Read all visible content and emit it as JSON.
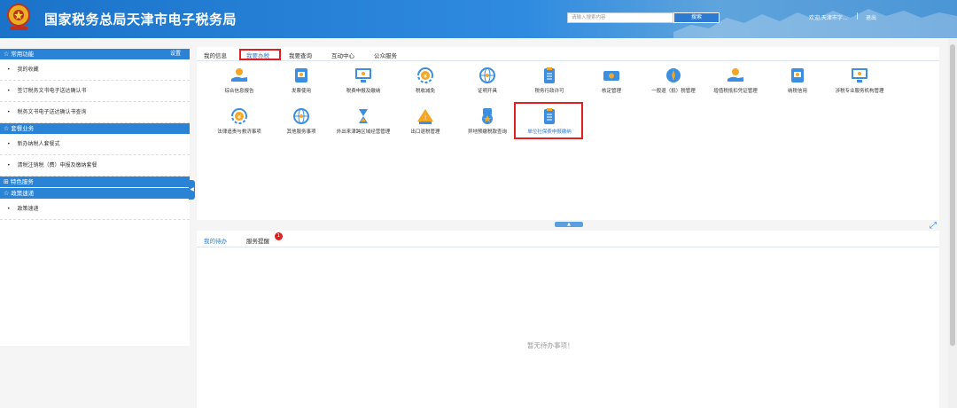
{
  "header": {
    "title": "国家税务总局天津市电子税务局",
    "search_placeholder": "请输入搜索内容",
    "search_button": "搜索",
    "welcome": "欢迎,天津市字...",
    "separator": "|",
    "logout": "退出"
  },
  "sidebar": {
    "sections": [
      {
        "title": "常用功能",
        "icon": "star-icon",
        "action": "设置",
        "items": [
          "我的收藏",
          "签订税务文书电子送达确认书",
          "税务文书电子送达确认书查询"
        ]
      },
      {
        "title": "套餐业务",
        "icon": "star-icon",
        "items": [
          "新办纳税人套餐式",
          "清税注销税（费）申报及缴纳套餐"
        ]
      },
      {
        "title": "特色服务",
        "icon": "grid-icon",
        "items": []
      },
      {
        "title": "政策速递",
        "icon": "star-icon",
        "items": [
          "政策速递"
        ]
      }
    ],
    "collapse_glyph": "◀"
  },
  "main": {
    "tabs": [
      "我的信息",
      "我要办税",
      "我要查询",
      "互动中心",
      "公众服务"
    ],
    "active_tab": "我要办税",
    "grid_row1": [
      {
        "label": "综合信息报告",
        "icon": "hand-coin-icon"
      },
      {
        "label": "发票使用",
        "icon": "invoice-icon"
      },
      {
        "label": "税费申报及缴纳",
        "icon": "monitor-icon"
      },
      {
        "label": "税收减免",
        "icon": "yuan-refresh-icon"
      },
      {
        "label": "证明开具",
        "icon": "globe-icon"
      },
      {
        "label": "税务行政许可",
        "icon": "clipboard-icon"
      },
      {
        "label": "核定管理",
        "icon": "ticket-icon"
      },
      {
        "label": "一般退（抵）税管理",
        "icon": "compass-icon"
      },
      {
        "label": "增值税抵扣凭证管理",
        "icon": "hand-coin-icon"
      },
      {
        "label": "纳税信用",
        "icon": "invoice-icon"
      },
      {
        "label": "涉税专业服务机构管理",
        "icon": "monitor-icon"
      }
    ],
    "grid_row2": [
      {
        "label": "法律追责与救济事项",
        "icon": "yuan-refresh-icon"
      },
      {
        "label": "其他服务事项",
        "icon": "globe-icon"
      },
      {
        "label": "外出来津跨区域经营管理",
        "icon": "hourglass-icon"
      },
      {
        "label": "出口退税管理",
        "icon": "warning-icon"
      },
      {
        "label": "异地预缴税款查询",
        "icon": "medal-icon"
      },
      {
        "label": "单位社保费申报缴纳",
        "icon": "clipboard-icon"
      }
    ],
    "pull_glyph": "▲",
    "expand_glyph": "⤢"
  },
  "bottom": {
    "tabs": [
      "我的待办",
      "服务提醒"
    ],
    "badge": "1",
    "empty_text": "暂无待办事项！"
  },
  "colors": {
    "primary": "#2b83d6",
    "highlight": "#e02020",
    "icon_orange": "#f5a623",
    "icon_blue": "#3b8ee0"
  }
}
